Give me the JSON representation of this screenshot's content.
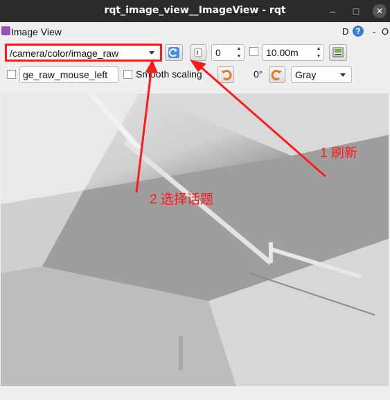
{
  "window": {
    "title": "rqt_image_view__ImageView - rqt",
    "minimize": "–",
    "maximize": "□",
    "close": "✕"
  },
  "plugin": {
    "title": "Image View",
    "d_label": "D",
    "help_label": "?",
    "dash_label": "-",
    "o_label": "O"
  },
  "toolbar": {
    "topic_value": "/camera/color/image_raw",
    "spin_value": "0",
    "duration_value": "10.00m",
    "mouse_topic_value": "ge_raw_mouse_left",
    "smooth_label": "Smooth scaling",
    "rotation_value": "0°",
    "color_scheme_value": "Gray"
  },
  "annotations": {
    "refresh": "1 刷新",
    "select_topic": "2 选择话题",
    "color": "#ff1a1a"
  },
  "icons": [
    "refresh-icon",
    "save-icon",
    "rotate-left-icon",
    "rotate-right-icon",
    "screenshot-icon"
  ]
}
